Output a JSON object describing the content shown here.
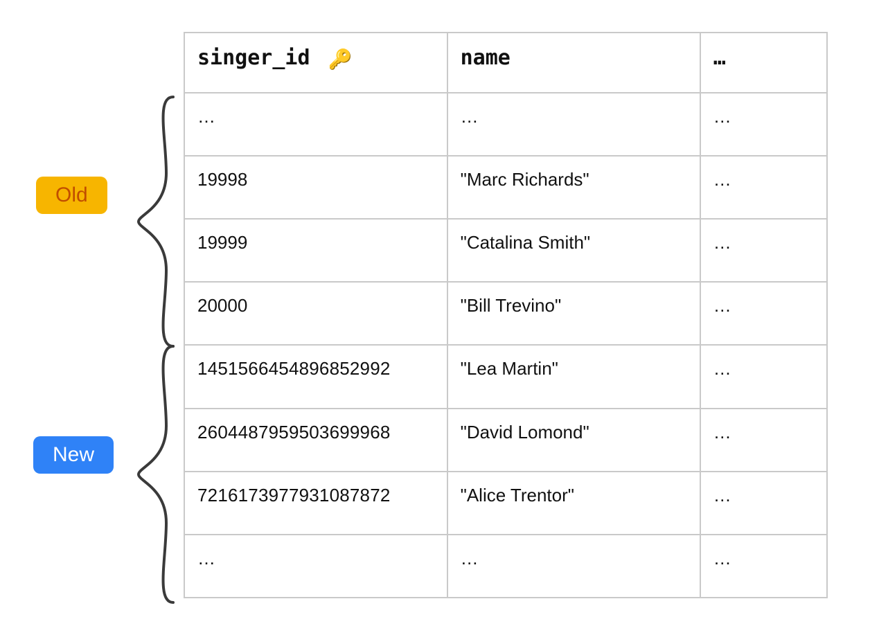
{
  "labels": {
    "old": "Old",
    "new": "New"
  },
  "columns": {
    "id": "singer_id",
    "key_icon": "🔑",
    "name": "name",
    "more": "…"
  },
  "rows": [
    {
      "id": "…",
      "name": "…",
      "more": "…",
      "group": "old",
      "smallid": false
    },
    {
      "id": "19998",
      "name": "\"Marc Richards\"",
      "more": "…",
      "group": "old",
      "smallid": false
    },
    {
      "id": "19999",
      "name": "\"Catalina Smith\"",
      "more": "…",
      "group": "old",
      "smallid": false
    },
    {
      "id": "20000",
      "name": "\"Bill Trevino\"",
      "more": "…",
      "group": "old",
      "smallid": false
    },
    {
      "id": "1451566454896852992",
      "name": "\"Lea Martin\"",
      "more": "…",
      "group": "new",
      "smallid": true
    },
    {
      "id": "2604487959503699968",
      "name": "\"David Lomond\"",
      "more": "…",
      "group": "new",
      "smallid": true
    },
    {
      "id": "7216173977931087872",
      "name": "\"Alice Trentor\"",
      "more": "…",
      "group": "new",
      "smallid": true
    },
    {
      "id": "…",
      "name": "…",
      "more": "…",
      "group": "new",
      "smallid": false
    }
  ]
}
